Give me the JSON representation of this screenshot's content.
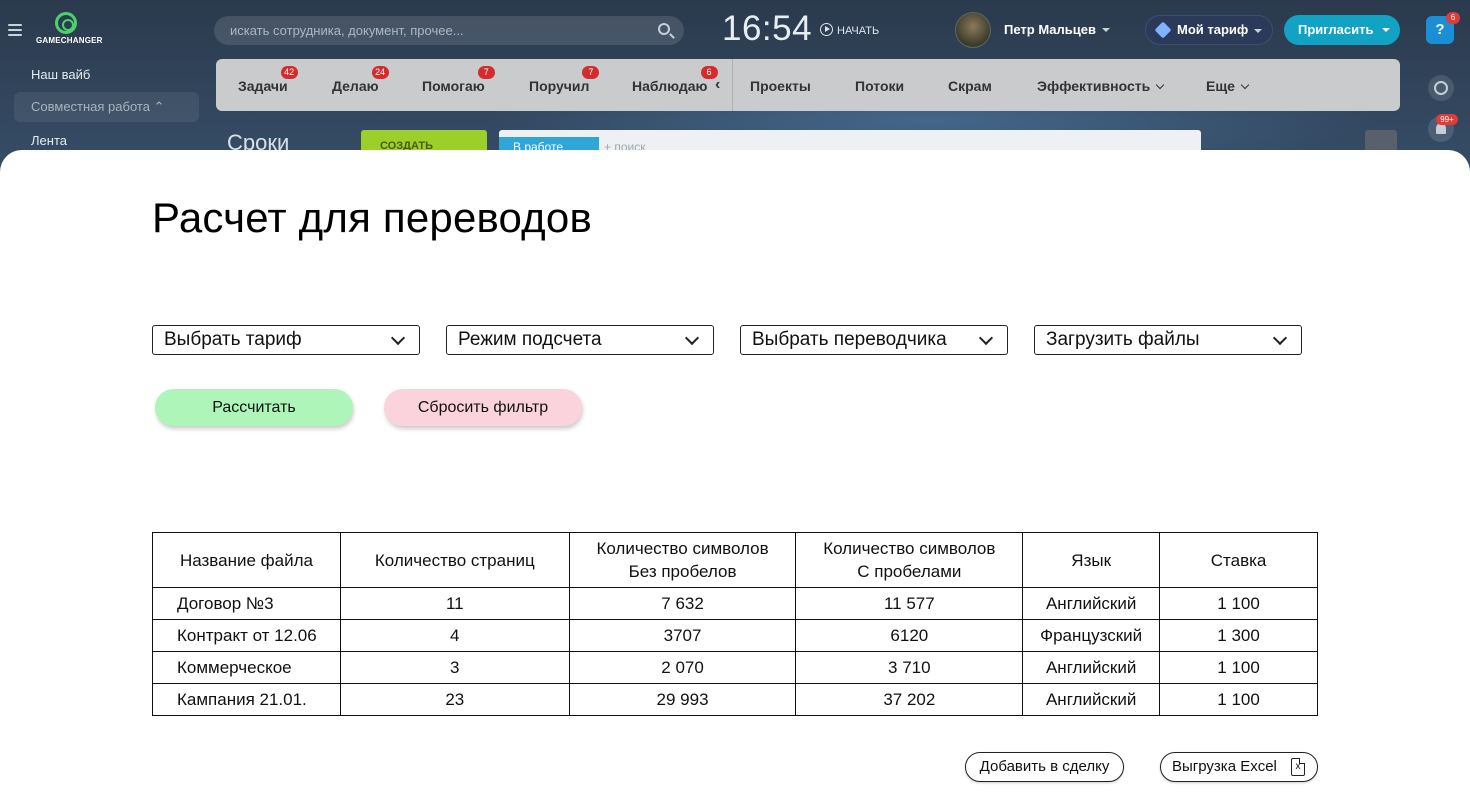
{
  "app": {
    "logo_text": "GAMECHANGER",
    "search_placeholder": "искать сотрудника, документ, прочее...",
    "clock": "16:54",
    "start_label": "НАЧАТЬ",
    "user_name": "Петр Мальцев",
    "tariff_label": "Мой тариф",
    "invite_label": "Пригласить",
    "help_label": "?",
    "help_badge": "6",
    "bell_badge": "99+"
  },
  "sidebar": {
    "items": [
      {
        "label": "Наш вайб"
      },
      {
        "label": "Совместная работа ⌃"
      },
      {
        "label": "Лента"
      }
    ]
  },
  "tabs": [
    {
      "label": "Задачи",
      "count": "42"
    },
    {
      "label": "Делаю",
      "count": "24"
    },
    {
      "label": "Помогаю",
      "count": "7"
    },
    {
      "label": "Поручил",
      "count": "7"
    },
    {
      "label": "Наблюдаю",
      "count": "6"
    },
    {
      "label": "Проекты"
    },
    {
      "label": "Потоки"
    },
    {
      "label": "Скрам"
    },
    {
      "label": "Эффективность"
    },
    {
      "label": "Еще"
    }
  ],
  "page_under": {
    "title": "Сроки",
    "create_label": "СОЗДАТЬ",
    "filter_chip": "В работе",
    "filter_placeholder": "+ поиск"
  },
  "modal": {
    "title": "Расчет для переводов",
    "selects": [
      {
        "label": "Выбрать тариф"
      },
      {
        "label": "Режим подсчета"
      },
      {
        "label": "Выбрать переводчика"
      },
      {
        "label": "Загрузить файлы"
      }
    ],
    "calc_label": "Рассчитать",
    "reset_label": "Сбросить фильтр",
    "table": {
      "headers": [
        {
          "l1": "Название файла",
          "l2": ""
        },
        {
          "l1": "Количество страниц",
          "l2": ""
        },
        {
          "l1": "Количество символов",
          "l2": "Без пробелов"
        },
        {
          "l1": "Количество символов",
          "l2": "С пробелами"
        },
        {
          "l1": "Язык",
          "l2": ""
        },
        {
          "l1": "Ставка",
          "l2": ""
        }
      ],
      "rows": [
        [
          "Договор №3",
          "11",
          "7 632",
          "11 577",
          "Английский",
          "1 100"
        ],
        [
          "Контракт от 12.06",
          "4",
          "3707",
          "6120",
          "Французский",
          "1 300"
        ],
        [
          "Коммерческое",
          "3",
          "2 070",
          "3 710",
          "Английский",
          "1 100"
        ],
        [
          "Кампания 21.01.",
          "23",
          "29 993",
          "37 202",
          "Английский",
          "1 100"
        ]
      ]
    },
    "add_deal_label": "Добавить в сделку",
    "excel_label": "Выгрузка Excel",
    "excel_icon_text": "x"
  },
  "colors": {
    "calc_button": "#adf5b8",
    "reset_button": "#fbd3dc",
    "invite_button": "#12a3c4",
    "badge": "#d42c2c"
  },
  "icons": [
    "menu-icon",
    "search-icon",
    "play-icon",
    "chevron-down-icon",
    "settings-icon",
    "bell-icon",
    "excel-file-icon"
  ]
}
